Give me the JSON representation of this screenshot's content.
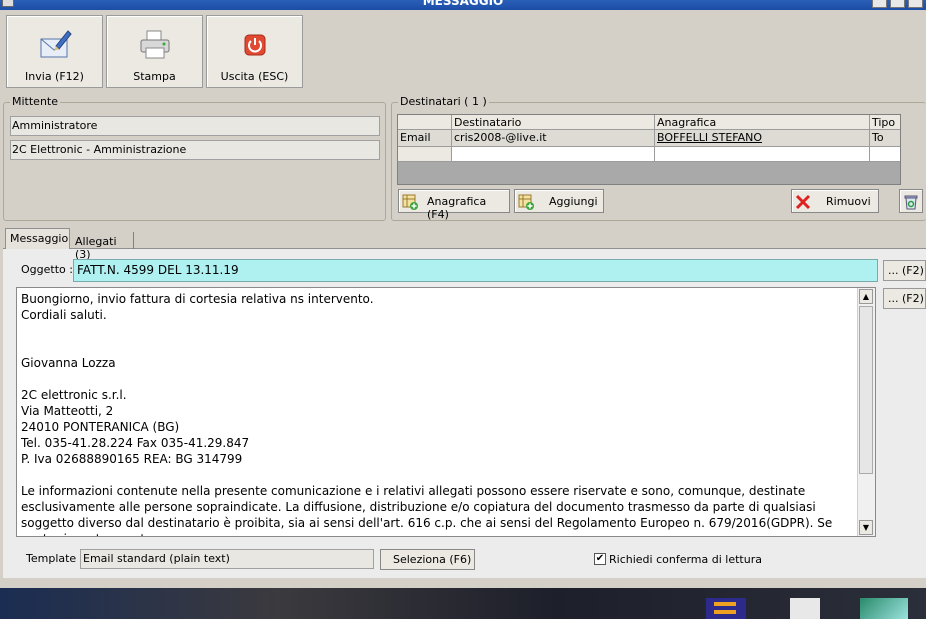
{
  "window": {
    "title": "MESSAGGIO"
  },
  "toolbar": {
    "send": "Invia (F12)",
    "print": "Stampa",
    "exit": "Uscita (ESC)"
  },
  "sender": {
    "label": "Mittente",
    "name": "Amministratore",
    "company": "2C Elettronic - Amministrazione"
  },
  "recipients": {
    "label": "Destinatari ( 1 )",
    "columns": [
      "Destinatario",
      "Anagrafica",
      "Tipo"
    ],
    "rows": [
      {
        "row_header": "Email",
        "destinatario": "cris2008-@live.it",
        "anagrafica": "BOFFELLI STEFANO",
        "tipo": "To"
      }
    ],
    "anagrafica_button": "Anagrafica (F4)",
    "add_button": "Aggiungi",
    "remove_button": "Rimuovi"
  },
  "tabs": {
    "message": "Messaggio",
    "attachments": "Allegati (3)"
  },
  "message": {
    "subject_label": "Oggetto :",
    "subject": "FATT.N. 4599 DEL 13.11.19",
    "f2_label": "... (F2)",
    "body": "Buongiorno, invio fattura di cortesia relativa ns intervento.\nCordiali saluti.\n\n\nGiovanna Lozza\n\n2C elettronic s.r.l.\nVia Matteotti, 2\n24010 PONTERANICA (BG)\nTel. 035-41.28.224 Fax 035-41.29.847\nP. Iva 02688890165 REA: BG 314799\n\nLe informazioni contenute nella presente comunicazione e i relativi allegati possono essere riservate e sono, comunque, destinate esclusivamente alle persone sopraindicate. La diffusione, distribuzione e/o copiatura del documento trasmesso da parte di qualsiasi soggetto diverso dal destinatario è proibita, sia ai sensi dell'art. 616 c.p. che ai sensi del Regolamento Europeo n. 679/2016(GDPR). Se avete ricevuto questo",
    "template_label": "Template :",
    "template_value": "Email standard (plain text)",
    "select_button": "Seleziona (F6)",
    "read_receipt_label": "Richiedi conferma di lettura",
    "read_receipt_checked": true
  },
  "colors": {
    "subject_bg": "#aff0f0",
    "title_bar": "#2a5fb8",
    "window_bg": "#d4d0c8"
  }
}
